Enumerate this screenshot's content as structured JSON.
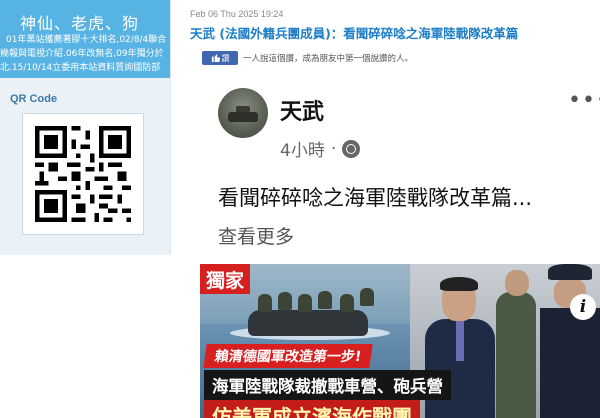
{
  "sidebar": {
    "banner_title": "神仙、老虎、狗",
    "banner_lines": [
      "01年黑站獲薦著膠十大排名,02/8/4聯合",
      "幾報與電視介紹.06年改無名,09年獨分於",
      "北.15/10/14立委用本站資料質詢國防部"
    ],
    "qr_title": "QR Code"
  },
  "article": {
    "date": "Feb 06 Thu 2025 19:24",
    "title": "天武 (法國外籍兵團成員)：看聞碎碎唸之海軍陸戰隊改革篇",
    "like_label": "讚",
    "like_text": "一人說這個讚，成為朋友中第一個說讚的人。"
  },
  "post": {
    "author": "天武",
    "time": "4小時",
    "dots": "•••",
    "text": "看聞碎碎唸之海軍陸戰隊改革篇...",
    "see_more": "查看更多",
    "image": {
      "exclusive": "獨家",
      "caption1": "賴清德國軍改造第一步!",
      "caption2": "海軍陸戰隊裁撤戰車營、砲兵營",
      "caption3": "仿美軍成立濱海作戰團",
      "info": "i"
    }
  },
  "colors": {
    "banner": "#57b3e4",
    "title_link": "#1e7ec8",
    "fb_like": "#4267b2",
    "news_red": "#d61f1f"
  },
  "icons": [
    "qr-code-icon",
    "thumbs-up-icon",
    "globe-icon",
    "more-options-icon",
    "info-icon"
  ]
}
